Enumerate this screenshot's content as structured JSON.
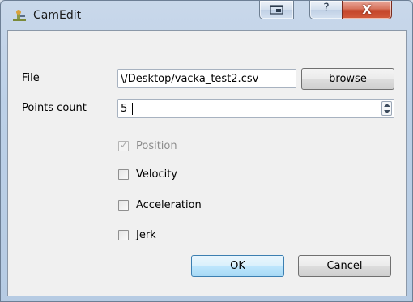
{
  "window": {
    "title": "CamEdit",
    "icon": "camedit-app-icon",
    "controls": {
      "restore_icon": "restore-icon",
      "help_glyph": "?",
      "close_glyph": "X"
    }
  },
  "form": {
    "file": {
      "label": "File",
      "value": "\\/Desktop/vacka_test2.csv",
      "browse_label": "browse"
    },
    "points": {
      "label": "Points count",
      "value": "5"
    },
    "options": [
      {
        "label": "Position",
        "checked": true,
        "enabled": false
      },
      {
        "label": "Velocity",
        "checked": false,
        "enabled": true
      },
      {
        "label": "Acceleration",
        "checked": false,
        "enabled": true
      },
      {
        "label": "Jerk",
        "checked": false,
        "enabled": true
      }
    ],
    "ok_label": "OK",
    "cancel_label": "Cancel"
  },
  "colors": {
    "titlebar": "#bcd0e7",
    "close_button": "#c4452a",
    "default_button_border": "#3c7fb1"
  }
}
